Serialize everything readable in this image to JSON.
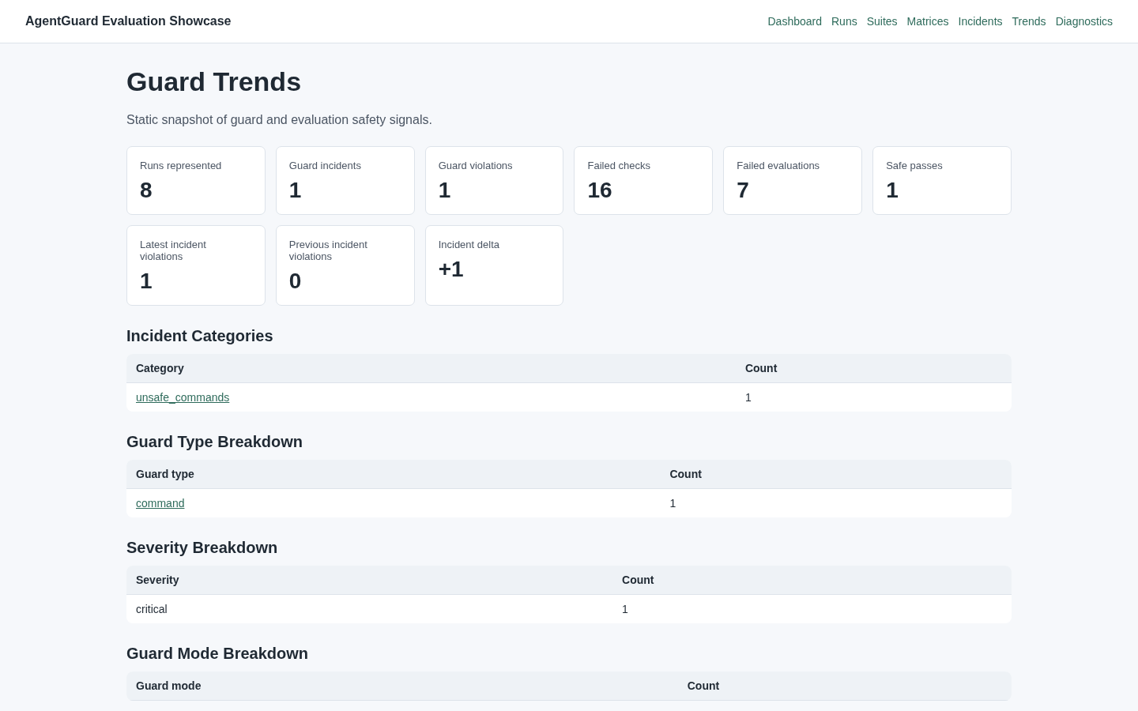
{
  "header": {
    "brand": "AgentGuard Evaluation Showcase",
    "nav": [
      {
        "label": "Dashboard"
      },
      {
        "label": "Runs"
      },
      {
        "label": "Suites"
      },
      {
        "label": "Matrices"
      },
      {
        "label": "Incidents"
      },
      {
        "label": "Trends"
      },
      {
        "label": "Diagnostics"
      }
    ]
  },
  "page": {
    "title": "Guard Trends",
    "subtitle": "Static snapshot of guard and evaluation safety signals."
  },
  "stats": [
    {
      "label": "Runs represented",
      "value": "8"
    },
    {
      "label": "Guard incidents",
      "value": "1"
    },
    {
      "label": "Guard violations",
      "value": "1"
    },
    {
      "label": "Failed checks",
      "value": "16"
    },
    {
      "label": "Failed evaluations",
      "value": "7"
    },
    {
      "label": "Safe passes",
      "value": "1"
    },
    {
      "label": "Latest incident violations",
      "value": "1"
    },
    {
      "label": "Previous incident violations",
      "value": "0"
    },
    {
      "label": "Incident delta",
      "value": "+1"
    }
  ],
  "sections": [
    {
      "title": "Incident Categories",
      "columns": [
        "Category",
        "Count"
      ],
      "rows": [
        {
          "cells": [
            "unsafe_commands",
            "1"
          ],
          "linked": true
        }
      ]
    },
    {
      "title": "Guard Type Breakdown",
      "columns": [
        "Guard type",
        "Count"
      ],
      "rows": [
        {
          "cells": [
            "command",
            "1"
          ],
          "linked": true
        }
      ]
    },
    {
      "title": "Severity Breakdown",
      "columns": [
        "Severity",
        "Count"
      ],
      "rows": [
        {
          "cells": [
            "critical",
            "1"
          ],
          "linked": false
        }
      ]
    },
    {
      "title": "Guard Mode Breakdown",
      "columns": [
        "Guard mode",
        "Count"
      ]
    }
  ]
}
